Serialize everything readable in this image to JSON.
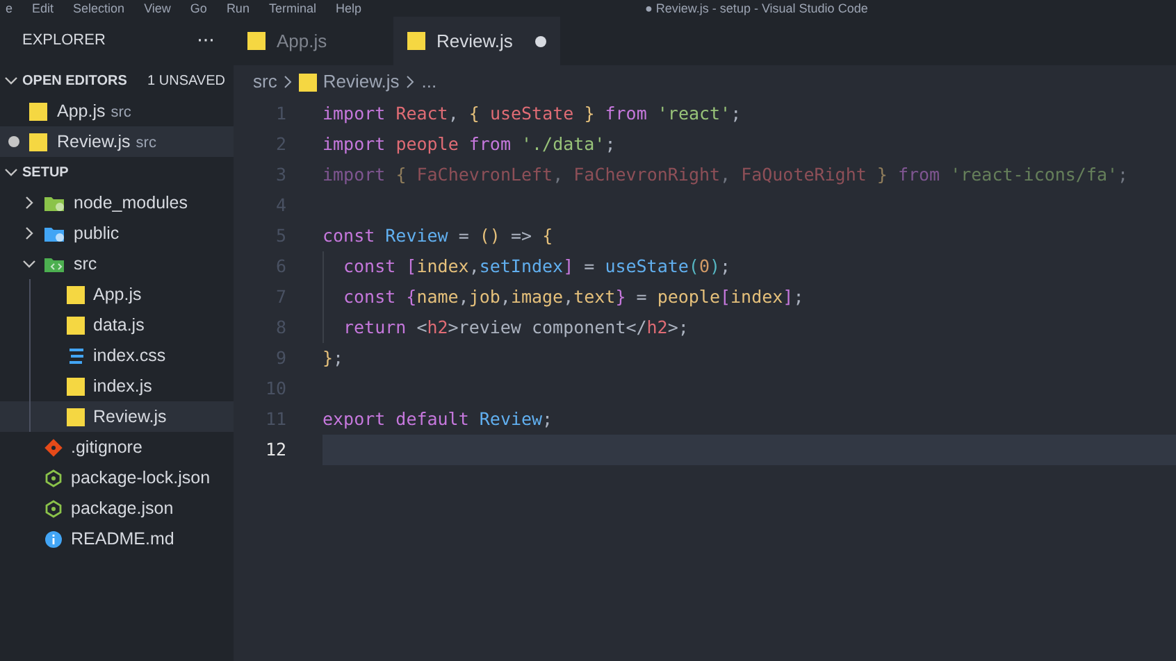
{
  "menu_bar": {
    "items": [
      "e",
      "Edit",
      "Selection",
      "View",
      "Go",
      "Run",
      "Terminal",
      "Help"
    ],
    "title": "● Review.js - setup - Visual Studio Code"
  },
  "sidebar": {
    "title": "EXPLORER",
    "more": "···",
    "open_editors": {
      "label": "OPEN EDITORS",
      "badge": "1 UNSAVED",
      "expanded": true,
      "items": [
        {
          "name": "App.js",
          "path": "src",
          "unsaved": false,
          "selected": false
        },
        {
          "name": "Review.js",
          "path": "src",
          "unsaved": true,
          "selected": true
        }
      ]
    },
    "project": {
      "label": "SETUP",
      "expanded": true,
      "items": [
        {
          "name": "node_modules",
          "kind": "folder-node",
          "expanded": false,
          "selected": false
        },
        {
          "name": "public",
          "kind": "folder-public",
          "expanded": false,
          "selected": false
        },
        {
          "name": "src",
          "kind": "folder-src",
          "expanded": true,
          "selected": false,
          "children": [
            {
              "name": "App.js",
              "kind": "js",
              "selected": false
            },
            {
              "name": "data.js",
              "kind": "js",
              "selected": false
            },
            {
              "name": "index.css",
              "kind": "css",
              "selected": false
            },
            {
              "name": "index.js",
              "kind": "js",
              "selected": false
            },
            {
              "name": "Review.js",
              "kind": "js",
              "selected": true
            }
          ]
        },
        {
          "name": ".gitignore",
          "kind": "git",
          "selected": false
        },
        {
          "name": "package-lock.json",
          "kind": "node",
          "selected": false
        },
        {
          "name": "package.json",
          "kind": "node",
          "selected": false
        },
        {
          "name": "README.md",
          "kind": "info",
          "selected": false
        }
      ]
    }
  },
  "tabs": [
    {
      "label": "App.js",
      "selected": false,
      "unsaved": false
    },
    {
      "label": "Review.js",
      "selected": true,
      "unsaved": true
    }
  ],
  "breadcrumb": [
    "src",
    "Review.js",
    "..."
  ],
  "code": [
    {
      "number": "1",
      "current": false,
      "indented": false,
      "dimmed": false,
      "tokens": [
        {
          "kind": "kw",
          "text": "import "
        },
        {
          "kind": "var",
          "text": "React"
        },
        {
          "kind": "p",
          "text": ", "
        },
        {
          "kind": "br",
          "text": "{ "
        },
        {
          "kind": "var",
          "text": "useState"
        },
        {
          "kind": "br",
          "text": " }"
        },
        {
          "kind": "kw",
          "text": " from "
        },
        {
          "kind": "str",
          "text": "'react'"
        },
        {
          "kind": "p",
          "text": ";"
        }
      ]
    },
    {
      "number": "2",
      "current": false,
      "indented": false,
      "dimmed": false,
      "tokens": [
        {
          "kind": "kw",
          "text": "import "
        },
        {
          "kind": "var",
          "text": "people"
        },
        {
          "kind": "kw",
          "text": " from "
        },
        {
          "kind": "str",
          "text": "'./data'"
        },
        {
          "kind": "p",
          "text": ";"
        }
      ]
    },
    {
      "number": "3",
      "current": false,
      "indented": false,
      "dimmed": true,
      "tokens": [
        {
          "kind": "kw",
          "text": "import "
        },
        {
          "kind": "br",
          "text": "{ "
        },
        {
          "kind": "var",
          "text": "FaChevronLeft"
        },
        {
          "kind": "p",
          "text": ", "
        },
        {
          "kind": "var",
          "text": "FaChevronRight"
        },
        {
          "kind": "p",
          "text": ", "
        },
        {
          "kind": "var",
          "text": "FaQuoteRight"
        },
        {
          "kind": "br",
          "text": " }"
        },
        {
          "kind": "kw",
          "text": " from "
        },
        {
          "kind": "str",
          "text": "'react-icons/fa'"
        },
        {
          "kind": "p",
          "text": ";"
        }
      ]
    },
    {
      "number": "4",
      "current": false
    },
    {
      "number": "5",
      "current": false,
      "indented": false,
      "dimmed": false,
      "tokens": [
        {
          "kind": "kw",
          "text": "const "
        },
        {
          "kind": "fn",
          "text": "Review"
        },
        {
          "kind": "p",
          "text": " = "
        },
        {
          "kind": "br",
          "text": "()"
        },
        {
          "kind": "p",
          "text": " => "
        },
        {
          "kind": "br",
          "text": "{"
        }
      ]
    },
    {
      "number": "6",
      "current": false,
      "indented": true,
      "dimmed": false,
      "tokens": [
        {
          "kind": "kw",
          "text": "const "
        },
        {
          "kind": "br2",
          "text": "["
        },
        {
          "kind": "var2",
          "text": "index"
        },
        {
          "kind": "p",
          "text": ","
        },
        {
          "kind": "prop",
          "text": "setIndex"
        },
        {
          "kind": "br2",
          "text": "]"
        },
        {
          "kind": "p",
          "text": " = "
        },
        {
          "kind": "fn",
          "text": "useState"
        },
        {
          "kind": "br3",
          "text": "("
        },
        {
          "kind": "num",
          "text": "0"
        },
        {
          "kind": "br3",
          "text": ")"
        },
        {
          "kind": "p",
          "text": ";"
        }
      ]
    },
    {
      "number": "7",
      "current": false,
      "indented": true,
      "dimmed": false,
      "tokens": [
        {
          "kind": "kw",
          "text": "const "
        },
        {
          "kind": "br2",
          "text": "{"
        },
        {
          "kind": "var2",
          "text": "name"
        },
        {
          "kind": "p",
          "text": ","
        },
        {
          "kind": "var2",
          "text": "job"
        },
        {
          "kind": "p",
          "text": ","
        },
        {
          "kind": "var2",
          "text": "image"
        },
        {
          "kind": "p",
          "text": ","
        },
        {
          "kind": "var2",
          "text": "text"
        },
        {
          "kind": "br2",
          "text": "}"
        },
        {
          "kind": "p",
          "text": " = "
        },
        {
          "kind": "var2",
          "text": "people"
        },
        {
          "kind": "br2",
          "text": "["
        },
        {
          "kind": "var2",
          "text": "index"
        },
        {
          "kind": "br2",
          "text": "]"
        },
        {
          "kind": "p",
          "text": ";"
        }
      ]
    },
    {
      "number": "8",
      "current": false,
      "indented": true,
      "dimmed": false,
      "tokens": [
        {
          "kind": "kw",
          "text": "return "
        },
        {
          "kind": "p",
          "text": "<"
        },
        {
          "kind": "tag",
          "text": "h2"
        },
        {
          "kind": "p",
          "text": ">review component</"
        },
        {
          "kind": "tag",
          "text": "h2"
        },
        {
          "kind": "p",
          "text": ">;"
        }
      ]
    },
    {
      "number": "9",
      "current": false,
      "indented": false,
      "dimmed": false,
      "tokens": [
        {
          "kind": "br",
          "text": "}"
        },
        {
          "kind": "p",
          "text": ";"
        }
      ]
    },
    {
      "number": "10",
      "current": false
    },
    {
      "number": "11",
      "current": false,
      "indented": false,
      "dimmed": false,
      "tokens": [
        {
          "kind": "kw",
          "text": "export default "
        },
        {
          "kind": "fn",
          "text": "Review"
        },
        {
          "kind": "p",
          "text": ";"
        }
      ]
    },
    {
      "number": "12",
      "current": true
    }
  ]
}
